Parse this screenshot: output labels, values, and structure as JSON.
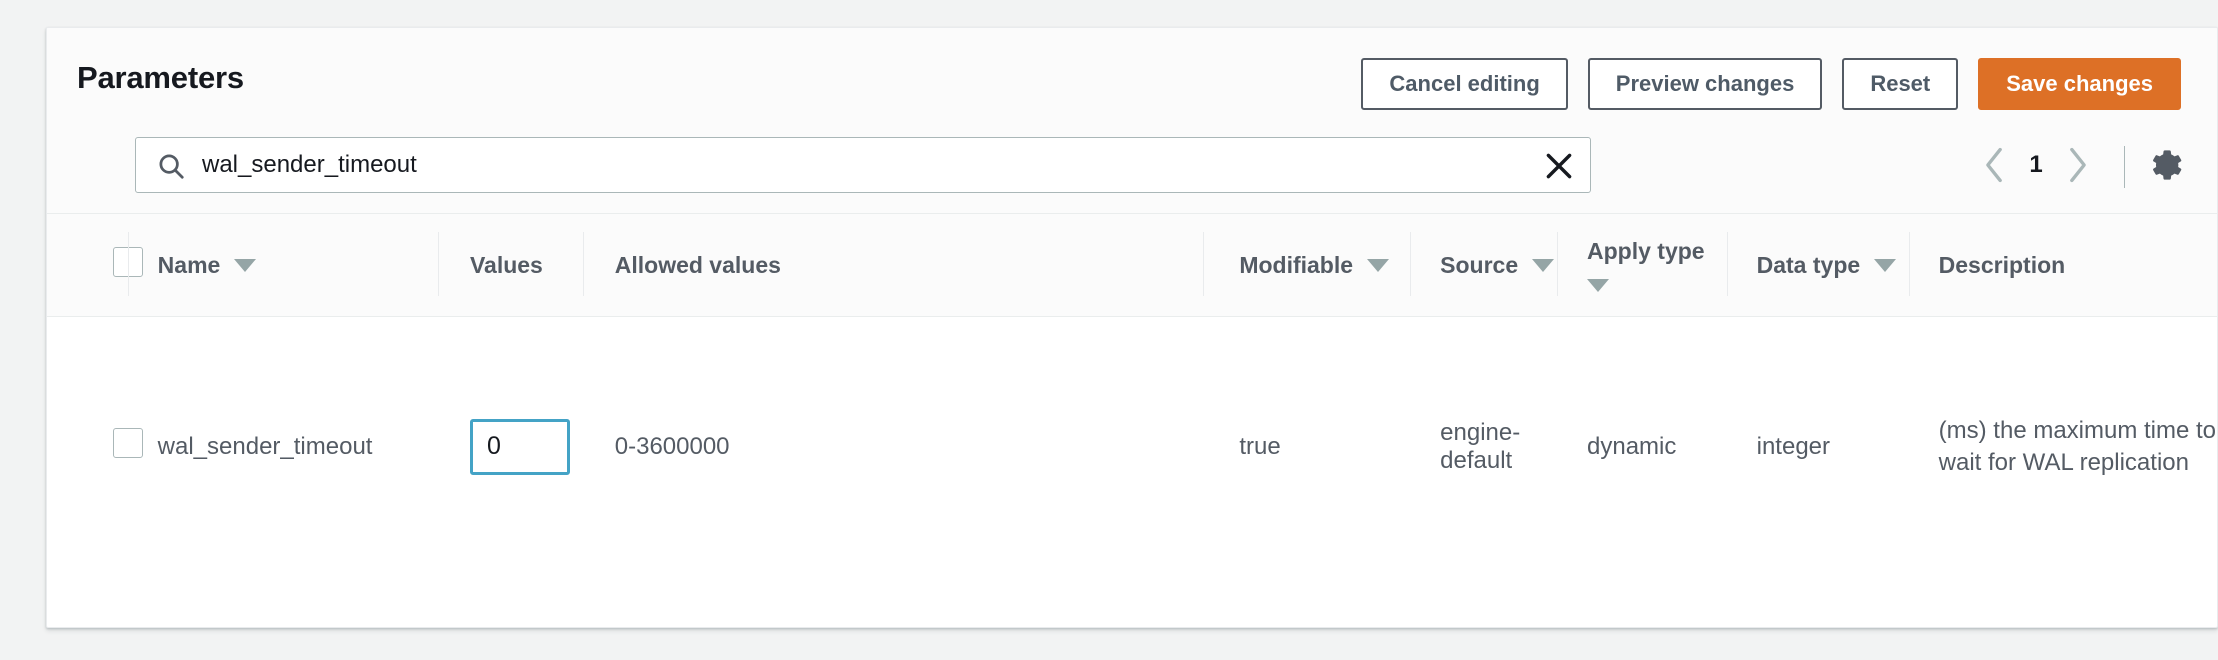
{
  "panel": {
    "title": "Parameters"
  },
  "toolbar": {
    "cancel_label": "Cancel editing",
    "preview_label": "Preview changes",
    "reset_label": "Reset",
    "save_label": "Save changes",
    "accent_color": "#dd7026"
  },
  "search": {
    "value": "wal_sender_timeout",
    "placeholder": "Filter parameters",
    "icon": "search-icon",
    "clear_icon": "close-icon"
  },
  "pagination": {
    "prev_icon": "chevron-left-icon",
    "page": "1",
    "next_icon": "chevron-right-icon",
    "settings_icon": "gear-icon"
  },
  "table": {
    "columns": [
      {
        "label": "",
        "sortable": false,
        "name": "select-all"
      },
      {
        "label": "Name",
        "sortable": true,
        "name": "name"
      },
      {
        "label": "Values",
        "sortable": false,
        "name": "values"
      },
      {
        "label": "Allowed values",
        "sortable": false,
        "name": "allowed-values"
      },
      {
        "label": "Modifiable",
        "sortable": true,
        "name": "modifiable"
      },
      {
        "label": "Source",
        "sortable": true,
        "name": "source"
      },
      {
        "label": "Apply type",
        "sortable": true,
        "name": "apply-type"
      },
      {
        "label": "Data type",
        "sortable": true,
        "name": "data-type"
      },
      {
        "label": "Description",
        "sortable": false,
        "name": "description"
      }
    ],
    "rows": [
      {
        "name": "wal_sender_timeout",
        "value": "0",
        "allowed_values": "0-3600000",
        "modifiable": "true",
        "source": "engine-default",
        "apply_type": "dynamic",
        "data_type": "integer",
        "description": "(ms) the maximum time to wait for WAL replication",
        "value_border_color": "#44a3c6"
      }
    ]
  }
}
